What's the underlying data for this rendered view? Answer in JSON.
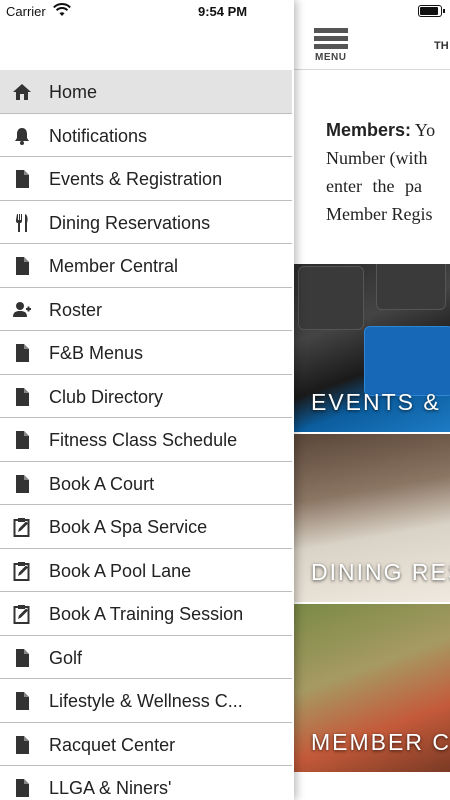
{
  "status_bar": {
    "carrier": "Carrier",
    "time": "9:54 PM"
  },
  "main": {
    "menu_label": "MENU",
    "header_title": "TH",
    "intro_lead": "Members:",
    "intro_lines": [
      "Yo",
      "Number (with",
      "enter the pa",
      "Member Regis"
    ],
    "tiles": [
      {
        "caption": "EVENTS &"
      },
      {
        "caption": "DINING RES"
      },
      {
        "caption": "MEMBER C"
      }
    ]
  },
  "drawer": {
    "items": [
      {
        "label": "Home",
        "icon": "home-icon"
      },
      {
        "label": "Notifications",
        "icon": "bell-icon"
      },
      {
        "label": "Events & Registration",
        "icon": "document-icon"
      },
      {
        "label": "Dining Reservations",
        "icon": "fork-knife-icon"
      },
      {
        "label": "Member Central",
        "icon": "document-icon"
      },
      {
        "label": "Roster",
        "icon": "people-icon"
      },
      {
        "label": "F&B Menus",
        "icon": "document-icon"
      },
      {
        "label": "Club Directory",
        "icon": "document-icon"
      },
      {
        "label": "Fitness Class Schedule",
        "icon": "document-icon"
      },
      {
        "label": "Book A Court",
        "icon": "document-icon"
      },
      {
        "label": "Book A Spa Service",
        "icon": "clipboard-edit-icon"
      },
      {
        "label": "Book A Pool Lane",
        "icon": "clipboard-edit-icon"
      },
      {
        "label": "Book A Training Session",
        "icon": "clipboard-edit-icon"
      },
      {
        "label": "Golf",
        "icon": "document-icon"
      },
      {
        "label": "Lifestyle & Wellness C...",
        "icon": "document-icon"
      },
      {
        "label": "Racquet Center",
        "icon": "document-icon"
      },
      {
        "label": "LLGA & Niners'",
        "icon": "document-icon"
      }
    ]
  }
}
